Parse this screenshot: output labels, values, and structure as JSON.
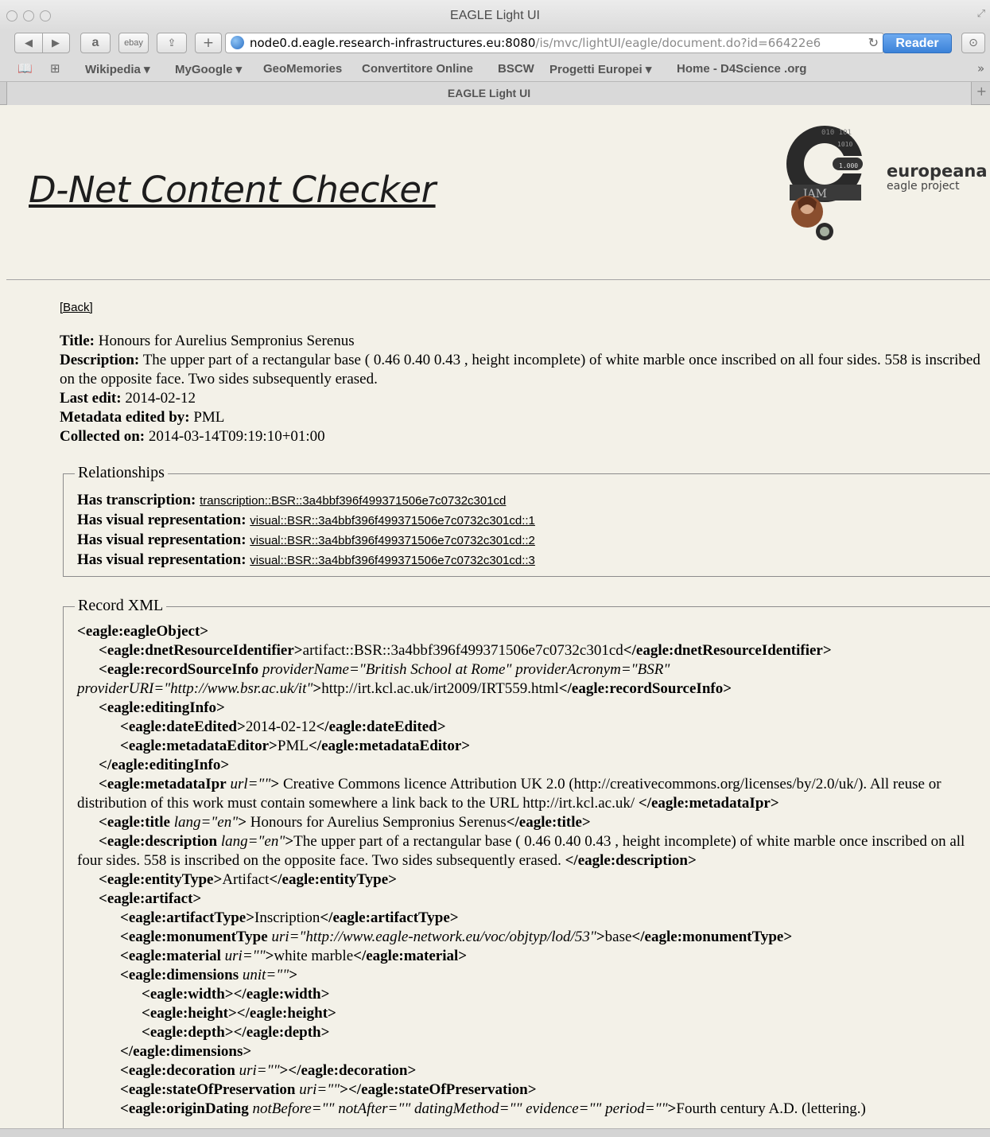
{
  "browser": {
    "window_title": "EAGLE Light UI",
    "url_host": "node0.d.eagle.research-infrastructures.eu:8080",
    "url_path": "/is/mvc/lightUI/eagle/document.do?id=66422e6",
    "reader_label": "Reader",
    "ebay_label": "ebay",
    "tab_title": "EAGLE Light UI",
    "bookmarks": [
      "Wikipedia ▾",
      "MyGoogle ▾",
      "GeoMemories",
      "Convertitore Online",
      "BSCW",
      "Progetti Europei ▾",
      "Home - D4Science .org"
    ]
  },
  "header": {
    "app_title": "D-Net Content Checker",
    "logo_main": "europeana",
    "logo_sub": "eagle project"
  },
  "back_label": "[Back]",
  "record": {
    "title_label": "Title:",
    "title": "Honours for Aurelius Sempronius Serenus",
    "description_label": "Description:",
    "description": "The upper part of a rectangular base ( 0.46 0.40 0.43 , height incomplete) of white marble once inscribed on all four sides. 558 is inscribed on the opposite face. Two sides subsequently erased.",
    "last_edit_label": "Last edit:",
    "last_edit": "2014-02-12",
    "edited_by_label": "Metadata edited by:",
    "edited_by": "PML",
    "collected_label": "Collected on:",
    "collected": "2014-03-14T09:19:10+01:00"
  },
  "relationships": {
    "legend": "Relationships",
    "items": [
      {
        "label": "Has transcription:",
        "link": "transcription::BSR::3a4bbf396f499371506e7c0732c301cd"
      },
      {
        "label": "Has visual representation:",
        "link": "visual::BSR::3a4bbf396f499371506e7c0732c301cd::1"
      },
      {
        "label": "Has visual representation:",
        "link": "visual::BSR::3a4bbf396f499371506e7c0732c301cd::2"
      },
      {
        "label": "Has visual representation:",
        "link": "visual::BSR::3a4bbf396f499371506e7c0732c301cd::3"
      }
    ]
  },
  "xml": {
    "legend": "Record XML",
    "eagleObject_open": "<eagle:eagleObject>",
    "dnet_open": "<eagle:dnetResourceIdentifier>",
    "dnet_value": "artifact::BSR::3a4bbf396f499371506e7c0732c301cd",
    "dnet_close": "</eagle:dnetResourceIdentifier>",
    "rsi_open": "<eagle:recordSourceInfo",
    "rsi_attr1": " providerName=\"British School at Rome\" providerAcronym=\"BSR\"",
    "rsi_attr2": "providerURI=\"http://www.bsr.ac.uk/it\"",
    "rsi_gt": ">",
    "rsi_value": "http://irt.kcl.ac.uk/irt2009/IRT559.html",
    "rsi_close": "</eagle:recordSourceInfo>",
    "editingInfo_open": "<eagle:editingInfo>",
    "dateEdited_open": "<eagle:dateEdited>",
    "dateEdited_value": "2014-02-12",
    "dateEdited_close": "</eagle:dateEdited>",
    "metaEditor_open": "<eagle:metadataEditor>",
    "metaEditor_value": "PML",
    "metaEditor_close": "</eagle:metadataEditor>",
    "editingInfo_close": "</eagle:editingInfo>",
    "ipr_open": "<eagle:metadataIpr",
    "ipr_attr": " url=\"\"",
    "ipr_gt": ">",
    "ipr_value": " Creative Commons licence Attribution UK 2.0 (http://creativecommons.org/licenses/by/2.0/uk/). All reuse or distribution of this work must contain somewhere a link back to the URL http://irt.kcl.ac.uk/ ",
    "ipr_close": "</eagle:metadataIpr>",
    "title_open": "<eagle:title",
    "title_attr": " lang=\"en\"",
    "title_gt": ">",
    "title_value": " Honours for Aurelius Sempronius Serenus",
    "title_close": "</eagle:title>",
    "desc_open": "<eagle:description",
    "desc_attr": " lang=\"en\"",
    "desc_gt": ">",
    "desc_value": "The upper part of a rectangular base ( 0.46 0.40 0.43 , height incomplete) of white marble once inscribed on all four sides. 558 is inscribed on the opposite face. Two sides subsequently erased. ",
    "desc_close": "</eagle:description>",
    "entity_open": "<eagle:entityType>",
    "entity_value": "Artifact",
    "entity_close": "</eagle:entityType>",
    "artifact_open": "<eagle:artifact>",
    "arttype_open": "<eagle:artifactType>",
    "arttype_value": "Inscription",
    "arttype_close": "</eagle:artifactType>",
    "monument_open": "<eagle:monumentType",
    "monument_attr": " uri=\"http://www.eagle-network.eu/voc/objtyp/lod/53\"",
    "monument_gt": ">",
    "monument_value": "base",
    "monument_close": "</eagle:monumentType>",
    "material_open": "<eagle:material",
    "material_attr": " uri=\"\"",
    "material_gt": ">",
    "material_value": "white marble",
    "material_close": "</eagle:material>",
    "dims_open": "<eagle:dimensions",
    "dims_attr": " unit=\"\"",
    "dims_gt": ">",
    "width_tags": "<eagle:width></eagle:width>",
    "height_tags": "<eagle:height></eagle:height>",
    "depth_tags": "<eagle:depth></eagle:depth>",
    "dims_close": "</eagle:dimensions>",
    "deco_open": "<eagle:decoration",
    "deco_attr": " uri=\"\"",
    "deco_rest": "></eagle:decoration>",
    "sop_open": "<eagle:stateOfPreservation",
    "sop_attr": " uri=\"\"",
    "sop_rest": "></eagle:stateOfPreservation>",
    "od_open": "<eagle:originDating",
    "od_attr": " notBefore=\"\" notAfter=\"\" datingMethod=\"\" evidence=\"\" period=\"\"",
    "od_gt": ">",
    "od_value": "Fourth century A.D. (lettering.)"
  }
}
